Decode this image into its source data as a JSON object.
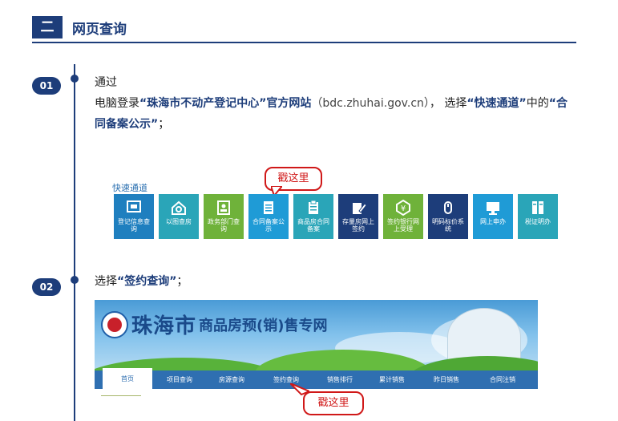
{
  "section": {
    "number": "二",
    "title": "网页查询"
  },
  "steps": [
    {
      "badge": "01",
      "line1": "通过"
    },
    {
      "badge": "02"
    }
  ],
  "step1": {
    "prefix": "电脑登录",
    "site_bold": "“珠海市不动产登记中心”官方网站",
    "url": "（bdc.zhuhai.gov.cn）",
    "choose": "， 选择",
    "quick_bold": "“快速通道”",
    "middle": "中的",
    "contract_bold": "“合同备案公示”",
    "end": "；"
  },
  "quick_nav": {
    "title": "快速通道",
    "tiles": [
      {
        "label": "登记信息查询",
        "color": "#1f7fbf",
        "icon": "monitor-icon"
      },
      {
        "label": "以图查房",
        "color": "#2aa5b8",
        "icon": "house-search-icon"
      },
      {
        "label": "政务部门查询",
        "color": "#6fb23a",
        "icon": "id-card-icon"
      },
      {
        "label": "合同备案公示",
        "color": "#1f9bd6",
        "icon": "document-list-icon"
      },
      {
        "label": "商品房合同备案",
        "color": "#2aa5b8",
        "icon": "clipboard-icon"
      },
      {
        "label": "存量房网上签约",
        "color": "#1d3d7a",
        "icon": "edit-icon"
      },
      {
        "label": "签约银行网上受理",
        "color": "#6fb23a",
        "icon": "yuan-icon"
      },
      {
        "label": "明码标价系统",
        "color": "#1d3d7a",
        "icon": "mouse-icon"
      },
      {
        "label": "网上申办",
        "color": "#1f9bd6",
        "icon": "display-icon"
      },
      {
        "label": "税证明办",
        "color": "#2aa5b8",
        "icon": "tax-icon"
      }
    ]
  },
  "callout_text": "戳这里",
  "step2": {
    "prefix": "选择",
    "bold": "“签约查询”",
    "end": "；"
  },
  "banner": {
    "name": "珠海市",
    "sub": "商品房预(销)售专网",
    "nav": [
      "首页",
      "项目查询",
      "房源查询",
      "签约查询",
      "销售排行",
      "累计销售",
      "昨日销售",
      "合同注销"
    ]
  },
  "colors": {
    "primary": "#1d3d7a",
    "callout": "#d01818",
    "nav": "#2f6fb1"
  }
}
